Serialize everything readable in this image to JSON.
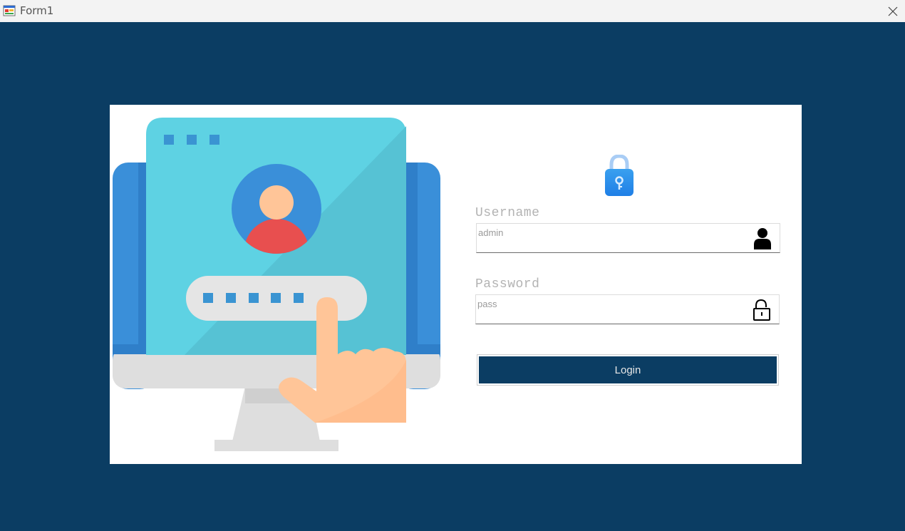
{
  "window": {
    "title": "Form1",
    "app_icon": "winforms-app-icon",
    "close_icon": "close-icon"
  },
  "colors": {
    "background": "#0b3d63",
    "panel": "#ffffff",
    "button": "#0b3d63",
    "label": "#b3b3b3"
  },
  "illustration": {
    "icon": "computer-login-illustration"
  },
  "logo": {
    "icon": "padlock-key-icon"
  },
  "form": {
    "username_label": "Username",
    "username_value": "admin",
    "username_icon": "user-icon",
    "password_label": "Password",
    "password_value": "pass",
    "password_icon": "unlock-icon",
    "login_label": "Login"
  }
}
